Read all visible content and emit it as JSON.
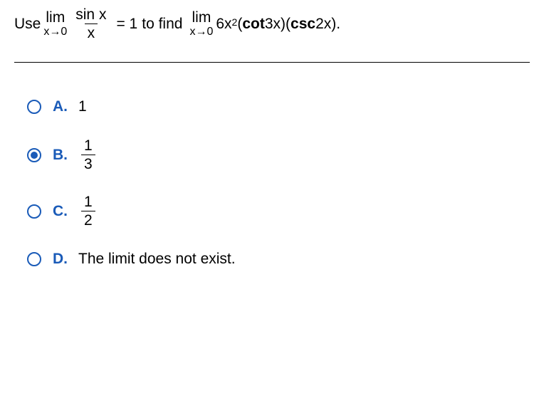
{
  "question": {
    "prefix": "Use",
    "lim_label": "lim",
    "lim_sub": "x→0",
    "frac_num": "sin x",
    "frac_den": "x",
    "eq_one": "= 1",
    "to_find": "to find",
    "six_x": "6x",
    "exp2": "2",
    "open_paren": "(",
    "cot": "cot",
    "threex": " 3x)(",
    "csc": "csc",
    "twox": " 2x)."
  },
  "options": {
    "a": {
      "label": "A.",
      "value": "1"
    },
    "b": {
      "label": "B.",
      "num": "1",
      "den": "3"
    },
    "c": {
      "label": "C.",
      "num": "1",
      "den": "2"
    },
    "d": {
      "label": "D.",
      "value": "The limit does not exist."
    }
  },
  "selected": "b"
}
